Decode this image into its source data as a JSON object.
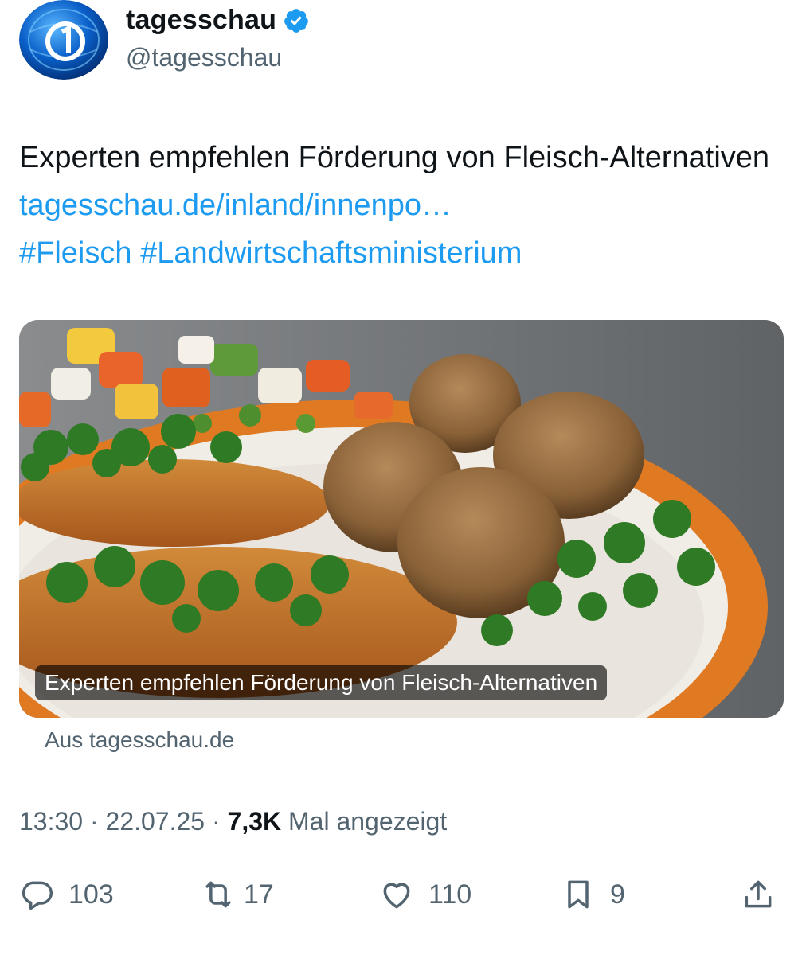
{
  "account": {
    "display_name": "tagesschau",
    "handle": "@tagesschau",
    "verified": true,
    "avatar_icon": "tagesschau-logo-icon",
    "verified_icon": "verified-badge-icon"
  },
  "tweet": {
    "text": "Experten empfehlen Förderung von Fleisch-Alternativen",
    "link": "tagesschau.de/inland/innenpo…",
    "hashtags": [
      "#Fleisch",
      "#Landwirtschaftsministerium"
    ]
  },
  "card": {
    "caption": "Experten empfehlen Förderung von Fleisch-Alternativen",
    "source": "Aus tagesschau.de"
  },
  "meta": {
    "time": "13:30",
    "separator": "·",
    "date": "22.07.25",
    "views": "7,3K",
    "views_label": "Mal angezeigt"
  },
  "actions": {
    "replies": "103",
    "reposts": "17",
    "likes": "110",
    "bookmarks": "9"
  },
  "colors": {
    "link": "#1d9bf0",
    "secondary_text": "#536471",
    "primary_text": "#0f1419",
    "verified": "#1d9bf0"
  }
}
